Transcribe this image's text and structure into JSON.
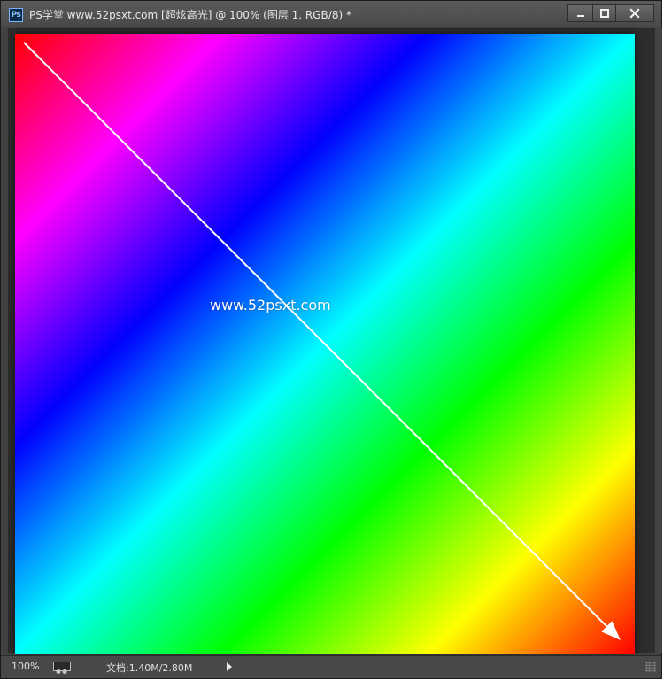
{
  "window": {
    "app_icon_label": "Ps",
    "title": "PS学堂 www.52psxt.com [超炫高光] @ 100% (图层 1, RGB/8) *"
  },
  "canvas": {
    "watermark": "www.52psxt.com",
    "gradient_colors": [
      "#ff0000",
      "#ff00ff",
      "#0000ff",
      "#00ffff",
      "#00ff00",
      "#ffff00",
      "#ff0000"
    ],
    "arrow_color": "#ffffff"
  },
  "status": {
    "zoom": "100%",
    "doc_info": "文档:1.40M/2.80M"
  },
  "icons": {
    "minimize": "minimize-icon",
    "maximize": "maximize-icon",
    "close": "close-icon",
    "proof": "proof-icon",
    "status_menu": "triangle-right-icon",
    "resize": "resize-grip-icon"
  }
}
